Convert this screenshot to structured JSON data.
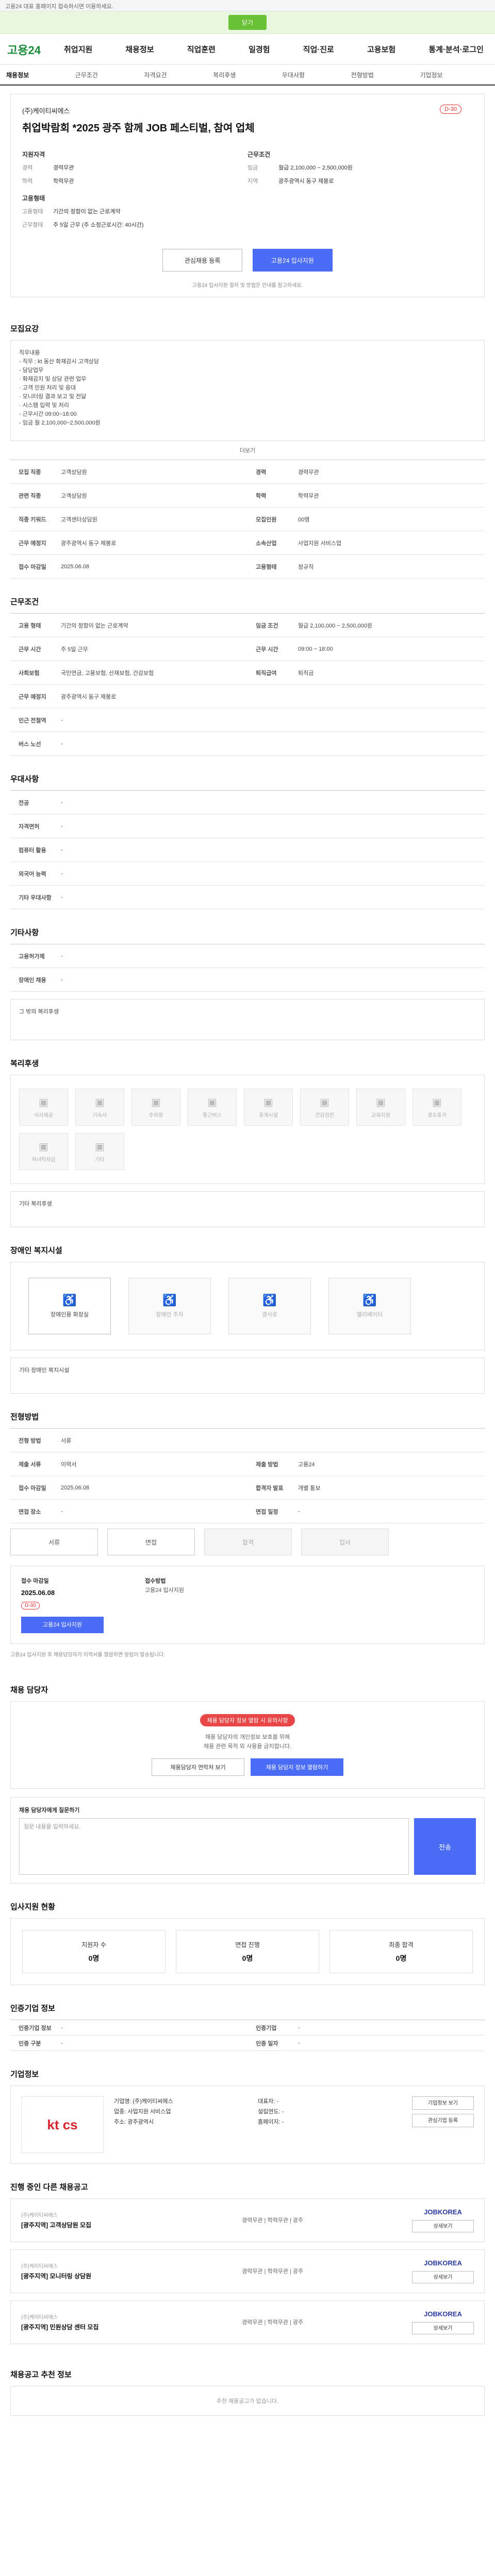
{
  "topbar": "고용24 대표 홈페이지 접속하시면 이용하세요.",
  "greenbar": "닫기",
  "logo": "고용24",
  "gnb": [
    "취업지원",
    "채용정보",
    "직업훈련",
    "일경험",
    "직업·진로",
    "고용보험",
    "통계·분석·로그인"
  ],
  "tabs": [
    "채용정보",
    "근무조건",
    "자격요건",
    "복리후생",
    "우대사항",
    "전형방법",
    "기업정보"
  ],
  "header": {
    "company": "(주)케이티씨에스",
    "title": "취업박람회 *2025 광주 함께 JOB 페스티벌, 참여 업체",
    "badge": "D-30"
  },
  "summary": {
    "left_title": "지원자격",
    "left": [
      [
        "경력",
        "경력무관"
      ],
      [
        "학력",
        "학력무관"
      ]
    ],
    "left2_title": "고용형태",
    "left2": [
      [
        "고용형태",
        "기간의 정함이 없는 근로계약"
      ],
      [
        "근무형태",
        "주 5일 근무 (주 소정근로시간: 40시간)"
      ]
    ],
    "right_title": "근무조건",
    "right": [
      [
        "임금",
        "월급 2,100,000 ~ 2,500,000원"
      ],
      [
        "지역",
        "광주광역시 동구 제봉로"
      ]
    ]
  },
  "buttons": {
    "save": "관심채용 등록",
    "apply": "고용24 입사지원"
  },
  "note": "고용24 입사지원 절차 및 방법은 안내를 참고하세요.",
  "sections": {
    "recruit": "모집요강",
    "work": "근무조건",
    "pref": "우대사항",
    "other": "기타사항",
    "welfare": "복리후생",
    "disability": "장애인 복지시설",
    "process": "전형방법",
    "method": "채용 담당자",
    "stats": "입사지원 현황",
    "reg": "인증기업 정보",
    "company": "기업정보",
    "similar": "진행 중인 다른 채용공고",
    "bottom": "채용공고 추천 정보"
  },
  "recruit_text": [
    "직무내용",
    "- 직무 : kt 동산 화재감시 고객상담",
    "- 담당업무",
    "· 화재감지 및 상담 관련 업무",
    "· 고객 민원 처리 및 응대",
    "· 모니터링 결과 보고 및 전달",
    "· 시스템 입력 및 처리",
    "- 근무시간 09:00~18:00",
    "- 임금 월 2,100,000~2,500,000원"
  ],
  "more": "더보기",
  "recruit_table": [
    [
      "모집 직종",
      "고객상담원",
      "경력",
      "경력무관"
    ],
    [
      "관련 직종",
      "고객상담원",
      "학력",
      "학력무관"
    ],
    [
      "직종 키워드",
      "고객센터상담원",
      "모집인원",
      "00명"
    ],
    [
      "근무 예정지",
      "광주광역시 동구 제봉로",
      "소속산업",
      "사업지원 서비스업"
    ],
    [
      "접수 마감일",
      "2025.06.08",
      "고용형태",
      "정규직"
    ]
  ],
  "work_table": [
    [
      "고용 형태",
      "기간의 정함이 없는 근로계약",
      "임금 조건",
      "월급 2,100,000 ~ 2,500,000원"
    ],
    [
      "근무 시간",
      "주 5일 근무",
      "근무 시간",
      "09:00 ~ 18:00"
    ],
    [
      "사회보험",
      "국민연금, 고용보험, 산재보험, 건강보험",
      "퇴직급여",
      "퇴직금"
    ],
    [
      "근무 예정지",
      "광주광역시 동구 제봉로",
      "",
      ""
    ],
    [
      "인근 전철역",
      "-",
      "",
      ""
    ],
    [
      "버스 노선",
      "-",
      "",
      ""
    ]
  ],
  "pref_table": [
    [
      "전공",
      "-"
    ],
    [
      "자격면허",
      "-"
    ],
    [
      "컴퓨터 활용",
      "-"
    ],
    [
      "외국어 능력",
      "-"
    ],
    [
      "기타 우대사항",
      "-"
    ]
  ],
  "other_table": [
    [
      "고용허가제",
      "-"
    ],
    [
      "장애인 채용",
      "-"
    ]
  ],
  "other_text": "그 밖의 복리후생",
  "welfare_icons": [
    "식사제공",
    "기숙사",
    "주차장",
    "통근버스",
    "휴게시설",
    "건강검진",
    "교육지원",
    "경조휴가",
    "자녀학자금",
    "기타"
  ],
  "welfare_etc": "기타 복리후생",
  "disab_icons": [
    "장애인용 화장실",
    "장애인 주차",
    "경사로",
    "엘리베이터"
  ],
  "disab_etc": "기타 장애인 복지시설",
  "process_table": [
    [
      "전형 방법",
      "서류",
      "",
      ""
    ],
    [
      "제출 서류",
      "이력서",
      "제출 방법",
      "고용24"
    ],
    [
      "접수 마감일",
      "2025.06.08",
      "합격자 발표",
      "개별 통보"
    ],
    [
      "면접 장소",
      "-",
      "면접 일정",
      "-"
    ]
  ],
  "steps": [
    "서류",
    "면접",
    "합격",
    "입사"
  ],
  "apply": {
    "label": "접수 마감일",
    "date": "2025.06.08",
    "dday": "D-30",
    "btn": "고용24 입사지원",
    "r1": "접수방법",
    "r2": "고용24 입사지원"
  },
  "notes": "고용24 입사지원 후 채용담당자가 이력서를 열람하면 알림이 발송됩니다.",
  "mgr": {
    "warn": "채용 담당자 정보 열람 시 유의사항",
    "p1": "채용 담당자의 개인정보 보호를 위해",
    "p2": "채용 관련 목적 외 사용을 금지합니다.",
    "b1": "채용담당자 연락처 보기",
    "b2": "채용 담당자 정보 열람하기"
  },
  "q": {
    "label": "채용 담당자에게 질문하기",
    "ph": "질문 내용을 입력하세요.",
    "send": "전송"
  },
  "stats_list": [
    [
      "지원자 수",
      "0명"
    ],
    [
      "면접 진행",
      "0명"
    ],
    [
      "최종 합격",
      "0명"
    ]
  ],
  "reg_table": [
    [
      "인증기업 정보",
      "-",
      "인증기업",
      "-"
    ],
    [
      "인증 구분",
      "-",
      "인증 일자",
      "-"
    ]
  ],
  "company_info": [
    "기업명: (주)케이티씨에스",
    "대표자: -",
    "업종: 사업지원 서비스업",
    "설립연도: -",
    "주소: 광주광역시",
    "홈페이지: -"
  ],
  "company_logo": "kt cs",
  "company_btns": [
    "기업정보 보기",
    "관심기업 등록"
  ],
  "jobs": [
    {
      "t": "[광주지역] 고객상담원 모집",
      "s": "(주)케이티씨에스",
      "m": "경력무관 | 학력무관 | 광주",
      "jk": "JOBKOREA",
      "btn": "상세보기"
    },
    {
      "t": "[광주지역] 모니터링 상담원",
      "s": "(주)케이티씨에스",
      "m": "경력무관 | 학력무관 | 광주",
      "jk": "JOBKOREA",
      "btn": "상세보기"
    },
    {
      "t": "[광주지역] 민원상담 센터 모집",
      "s": "(주)케이티씨에스",
      "m": "경력무관 | 학력무관 | 광주",
      "jk": "JOBKOREA",
      "btn": "상세보기"
    }
  ],
  "bottom_text": "추천 채용공고가 없습니다."
}
